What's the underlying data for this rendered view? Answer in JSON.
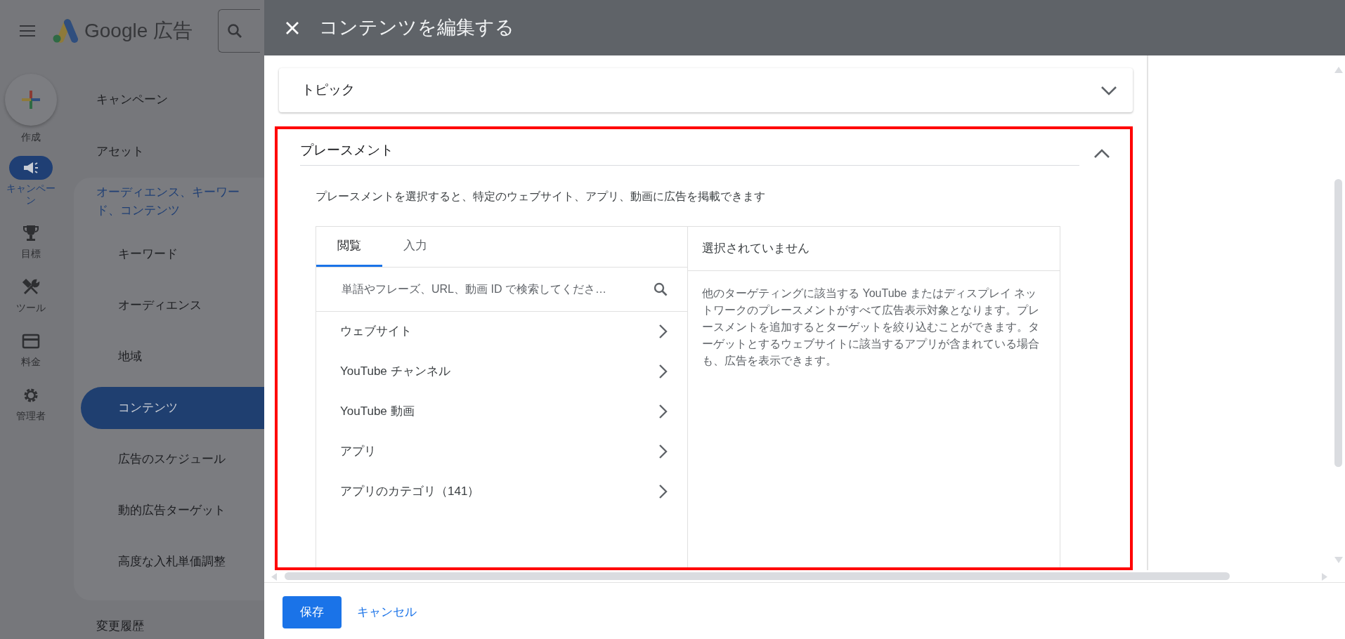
{
  "app": {
    "logo_text": "Google 広告",
    "create_label": "作成",
    "rail": [
      {
        "label": "キャンペーン",
        "selected": true
      },
      {
        "label": "目標",
        "selected": false
      },
      {
        "label": "ツール",
        "selected": false
      },
      {
        "label": "料金",
        "selected": false
      },
      {
        "label": "管理者",
        "selected": false
      }
    ],
    "nav": [
      {
        "label": "キャンペーン",
        "selected": false
      },
      {
        "label": "アセット",
        "selected": false
      },
      {
        "label": "オーディエンス、キーワード、コンテンツ",
        "selected": true,
        "children": [
          {
            "label": "キーワード",
            "selected": false
          },
          {
            "label": "オーディエンス",
            "selected": false
          },
          {
            "label": "地域",
            "selected": false
          },
          {
            "label": "コンテンツ",
            "selected": true
          },
          {
            "label": "広告のスケジュール",
            "selected": false
          },
          {
            "label": "動的広告ターゲット",
            "selected": false
          },
          {
            "label": "高度な入札単価調整",
            "selected": false
          }
        ]
      },
      {
        "label": "変更履歴",
        "selected": false
      }
    ]
  },
  "dialog": {
    "title": "コンテンツを編集する",
    "sections": [
      {
        "title": "トピック",
        "expanded": false,
        "highlighted": false
      },
      {
        "title": "プレースメント",
        "expanded": true,
        "highlighted": true,
        "description": "プレースメントを選択すると、特定のウェブサイト、アプリ、動画に広告を掲載できます",
        "tabs": [
          {
            "label": "閲覧",
            "selected": true
          },
          {
            "label": "入力",
            "selected": false
          }
        ],
        "search": {
          "placeholder": "単語やフレーズ、URL、動画 ID で検索してくださ…"
        },
        "categories": [
          "ウェブサイト",
          "YouTube チャンネル",
          "YouTube 動画",
          "アプリ",
          "アプリのカテゴリ（141）"
        ],
        "selection": {
          "title": "選択されていません",
          "message": "他のターゲティングに該当する YouTube またはディスプレイ ネットワークのプレースメントがすべて広告表示対象となります。プレースメントを追加するとターゲットを絞り込むことができます。ターゲットとするウェブサイトに該当するアプリが含まれている場合も、広告を表示できます。"
        }
      }
    ],
    "buttons": [
      {
        "label": "保存",
        "kind": "primary"
      },
      {
        "label": "キャンセル",
        "kind": "text"
      }
    ]
  }
}
